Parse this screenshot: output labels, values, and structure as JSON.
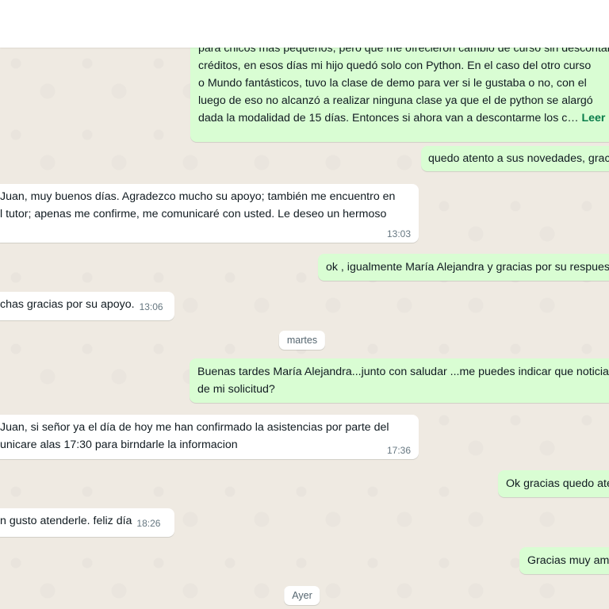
{
  "messages": {
    "m1": {
      "lines": [
        "para chicos más pequeños, pero que me ofrecieron cambio de curso sin descontar",
        "créditos, en esos días mi hijo quedó solo con Python. En el caso del otro curso",
        "o Mundo fantásticos, tuvo la clase de demo para ver si le gustaba o no, con el",
        "luego de eso no alcanzó a realizar ninguna clase ya que el de python se alargó",
        "dada la modalidad de 15 días. Entonces si ahora van a descontarme los c…"
      ],
      "more": "Leer más"
    },
    "m2": {
      "text": "quedo atento a sus novedades, gracias"
    },
    "m3": {
      "lines": [
        "Juan, muy buenos días. Agradezco mucho su apoyo; también me encuentro en",
        "l tutor; apenas me confirme, me comunicaré con usted. Le deseo un hermoso"
      ],
      "time": "13:03"
    },
    "m4": {
      "text": "ok , igualmente María Alejandra y gracias por su respuesta"
    },
    "m5": {
      "text": "chas gracias por su apoyo.",
      "time": "13:06"
    },
    "day1": "martes",
    "m6": {
      "lines": [
        "Buenas tardes María Alejandra...junto con saludar ...me puedes indicar que noticias",
        "de mi solicitud?"
      ]
    },
    "m7": {
      "lines": [
        "Juan, si señor ya el día de hoy me han confirmado la asistencias por parte del",
        "unicare alas 17:30 para birndarle la informacion"
      ],
      "time": "17:36"
    },
    "m8": {
      "text": "Ok gracias quedo atento"
    },
    "m9": {
      "text": "n gusto atenderle. feliz día",
      "time": "18:26"
    },
    "m10": {
      "text": "Gracias muy amable"
    },
    "day2": "Ayer"
  }
}
